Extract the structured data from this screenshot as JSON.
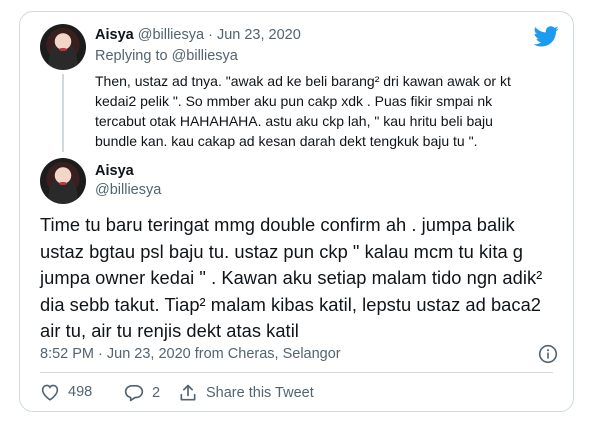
{
  "reply_tweet": {
    "name": "Aisya",
    "handle": "@billiesya",
    "separator": "·",
    "date": "Jun 23, 2020",
    "replying_to_prefix": "Replying to ",
    "replying_to_handle": "@billiesya",
    "lines": [
      "Then, ustaz ad tnya. \"awak ad ke beli barang² dri kawan awak or kt",
      "kedai2 pelik \". So mmber aku pun cakp xdk . Puas fikir smpai nk",
      "tercabut otak HAHAHAHA. astu aku ckp lah, \" kau hritu beli baju",
      "bundle kan. kau cakap ad kesan darah dekt tengkuk baju tu \"."
    ]
  },
  "main_tweet": {
    "name": "Aisya",
    "handle": "@billiesya",
    "lines": [
      "Time tu baru teringat mmg double confirm ah . jumpa balik",
      "ustaz bgtau psl baju tu. ustaz pun ckp \" kalau mcm tu kita g",
      "jumpa owner kedai \" . Kawan aku setiap malam tido ngn adik²",
      "dia sebb takut. Tiap² malam kibas katil, lepstu ustaz ad baca2",
      "air tu, air tu renjis dekt atas katil"
    ],
    "meta": "8:52 PM · Jun 23, 2020 from Cheras, Selangor"
  },
  "actions": {
    "likes": "498",
    "replies": "2",
    "share_label": "Share this Tweet"
  },
  "icons": {
    "brand": "twitter-bird-icon",
    "info": "info-icon",
    "like": "heart-icon",
    "reply": "reply-bubble-icon",
    "share": "share-icon"
  },
  "colors": {
    "brand": "#1d9bf0",
    "text": "#0f1419",
    "muted": "#536471",
    "border": "#cfd9de"
  }
}
